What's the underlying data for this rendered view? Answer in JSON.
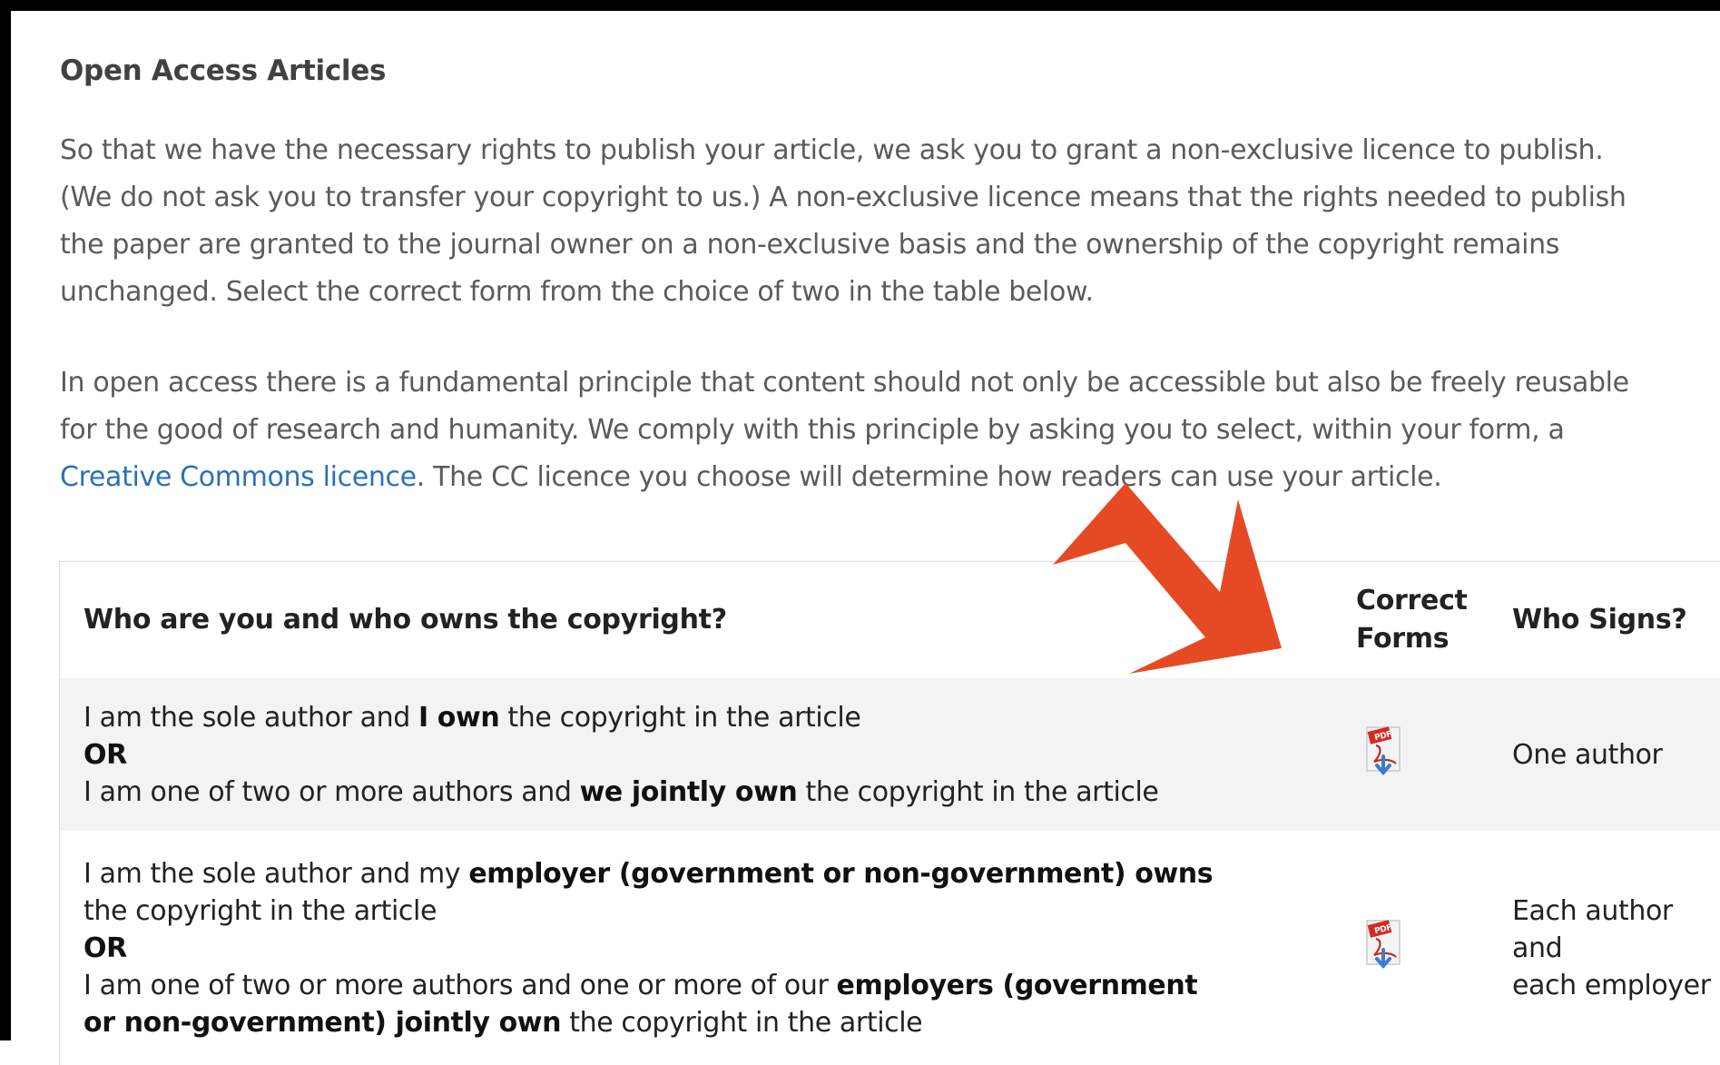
{
  "heading": "Open Access Articles",
  "para1": {
    "lines": [
      "So that we have the necessary rights to publish your article, we ask you to grant a non-exclusive licence to publish.",
      "(We do not ask you to transfer your copyright to us.) A non-exclusive licence means that the rights needed to publish",
      "the paper are granted to the journal owner on a non-exclusive basis and the ownership of the copyright remains",
      "unchanged. Select the correct form from the choice of two in the table below."
    ]
  },
  "para2": {
    "line1": "In open access there is a fundamental principle that content should not only be accessible but also be freely reusable",
    "line2": "for the good of research and humanity. We comply with this principle by asking you to select, within your form, a",
    "link": "Creative Commons licence",
    "line3_rest": ". The CC licence you choose will determine how readers can use your article."
  },
  "table": {
    "headers": {
      "who": "Who are you and who owns the copyright?",
      "forms_line1": "Correct",
      "forms_line2": "Forms",
      "signs": "Who Signs?"
    },
    "rows": [
      {
        "a1": "I am the sole author and ",
        "a1b": "I own",
        "a1c": " the copyright in the article",
        "or": "OR",
        "a2": "I am one of two or more authors and ",
        "a2b": "we jointly own",
        "a2c": " the copyright in the article",
        "form_icon": "pdf-file-icon",
        "signs": "One author"
      },
      {
        "a1": "I am the sole author and my ",
        "a1b": "employer (government or non-government) owns",
        "a1c": "the copyright in the article",
        "or": "OR",
        "a2": "I am one of two or more authors and one or more of our ",
        "a2b": "employers (government",
        "a2d": "or non-government) jointly own",
        "a2c": " the copyright in the article",
        "form_icon": "pdf-file-icon",
        "signs_line1": "Each author and",
        "signs_line2": "each employer"
      }
    ]
  },
  "annotation": {
    "arrow_color": "#e64a25",
    "icon": "annotation-arrow-icon"
  }
}
